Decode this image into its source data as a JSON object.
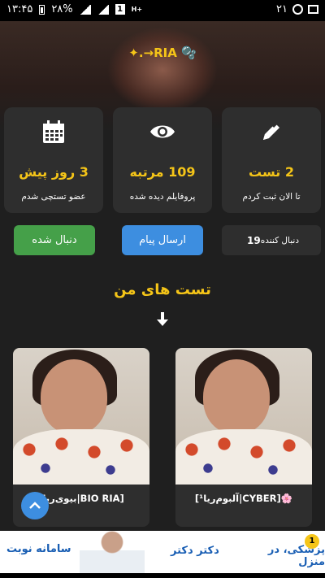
{
  "status_bar": {
    "time": "۱۳:۴۵",
    "battery": "۲۸%",
    "network_badge": "1",
    "network_type": "H+",
    "notification_count": "۲۱"
  },
  "profile": {
    "name": "✦.→RIA 🫧"
  },
  "stats": [
    {
      "icon": "calendar-icon",
      "value": "3 روز پیش",
      "label": "عضو تستچی شدم"
    },
    {
      "icon": "eye-icon",
      "value": "109 مرتبه",
      "label": "پروفایلم دیده شده"
    },
    {
      "icon": "pencil-icon",
      "value": "2 تست",
      "label": "تا الان ثبت کردم"
    }
  ],
  "actions": {
    "follow_label": "دنبال شده",
    "message_label": "ارسال پیام",
    "followers_count": "19",
    "followers_label": "دنبال کننده"
  },
  "section": {
    "title": "تست های من"
  },
  "tests": [
    {
      "caption": "[بیوی‌ریا|BIO RIA]"
    },
    {
      "caption": "[آلبوم‌ریا¹|CYBER]🌸"
    }
  ],
  "ad": {
    "left_text": "سامانه نوبت",
    "logo_text": "دکتر دکتر",
    "right_text": "پزشکی، در منزل",
    "badge": "1"
  },
  "colors": {
    "accent": "#f5c518",
    "follow_green": "#45a049",
    "message_blue": "#3d8ee0",
    "card_bg": "#2e2e2e",
    "page_bg": "#1f1f1f"
  }
}
